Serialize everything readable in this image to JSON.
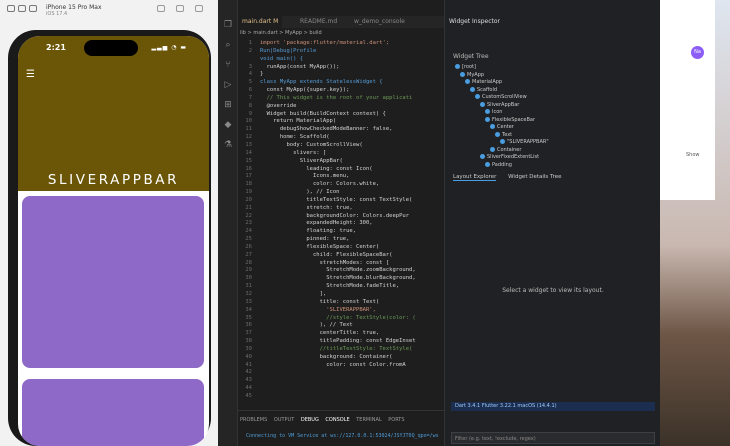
{
  "simulator": {
    "device": "iPhone 15 Pro Max",
    "os": "iOS 17.4",
    "time": "2:21",
    "app_title": "SLIVERAPPBAR",
    "menu_icon": "hamburger-icon",
    "appbar_color": "#6b5608",
    "card_color": "#8e69c8"
  },
  "editor": {
    "tabs": [
      "main.dart M",
      "README.md",
      "w_demo_console"
    ],
    "breadcrumb": "lib > main.dart > MyApp > build",
    "code": [
      "import 'package:flutter/material.dart';",
      "",
      "Run|Debug|Profile",
      "void main() {",
      "  runApp(const MyApp());",
      "}",
      "",
      "class MyApp extends StatelessWidget {",
      "  const MyApp({super.key});",
      "",
      "  // This widget is the root of your applicati",
      "  @override",
      "  Widget build(BuildContext context) {",
      "    return MaterialApp(",
      "      debugShowCheckedModeBanner: false,",
      "      home: Scaffold(",
      "        body: CustomScrollView(",
      "          slivers: [",
      "            SliverAppBar(",
      "              leading: const Icon(",
      "                Icons.menu,",
      "                color: Colors.white,",
      "              ), // Icon",
      "              titleTextStyle: const TextStyle(",
      "              stretch: true,",
      "              backgroundColor: Colors.deepPur",
      "              expandedHeight: 300,",
      "              floating: true,",
      "              pinned: true,",
      "              flexibleSpace: Center(",
      "                child: FlexibleSpaceBar(",
      "                  stretchModes: const [",
      "                    StretchMode.zoomBackground,",
      "                    StretchMode.blurBackground,",
      "                    StretchMode.fadeTitle,",
      "                  ],",
      "                  title: const Text(",
      "                    'SLIVERAPPBAR',",
      "                    //style: TextStyle(color: (",
      "                  ), // Text",
      "                  centerTitle: true,",
      "",
      "                  titlePadding: const EdgeInset",
      "                  //titleTextStyle: TextStyle(",
      "                  background: Container(",
      "                    color: const Color.fromA"
    ],
    "line_numbers": [
      "1",
      "2",
      "",
      "3",
      "4",
      "5",
      "6",
      "7",
      "8",
      "9",
      "10",
      "11",
      "12",
      "13",
      "14",
      "15",
      "16",
      "17",
      "18",
      "19",
      "20",
      "21",
      "22",
      "23",
      "24",
      "25",
      "26",
      "27",
      "28",
      "29",
      "30",
      "31",
      "32",
      "33",
      "34",
      "35",
      "36",
      "37",
      "38",
      "39",
      "40",
      "41",
      "42",
      "43",
      "44",
      "45"
    ],
    "panel_tabs": [
      "PROBLEMS",
      "OUTPUT",
      "DEBUG CONSOLE",
      "TERMINAL",
      "PORTS"
    ],
    "console_line": "Connecting to VM Service at ws://127.0.0.1:53024/JSYJT0Q_qpo=/ws"
  },
  "inspector": {
    "tab": "Widget Inspector",
    "tree_title": "Widget Tree",
    "tree": [
      "[root]",
      "MyApp",
      "MaterialApp",
      "Scaffold",
      "CustomScrollView",
      "SliverAppBar",
      "Icon",
      "FlexibleSpaceBar",
      "Center",
      "Text",
      "\"SLIVERAPPBAR\"",
      "Container",
      "SliverFixedExtentList",
      "Padding"
    ],
    "layout_tabs": [
      "Layout Explorer",
      "Widget Details Tree"
    ],
    "empty_msg": "Select a widget to view its layout.",
    "filter_placeholder": "Filter (e.g. text, !exclude, regex)",
    "status": "Dart  3.4.1  Flutter  3.22.1  macOS (14.4.1)"
  },
  "desktop": {
    "avatar": "Na",
    "side_text": "Show"
  }
}
